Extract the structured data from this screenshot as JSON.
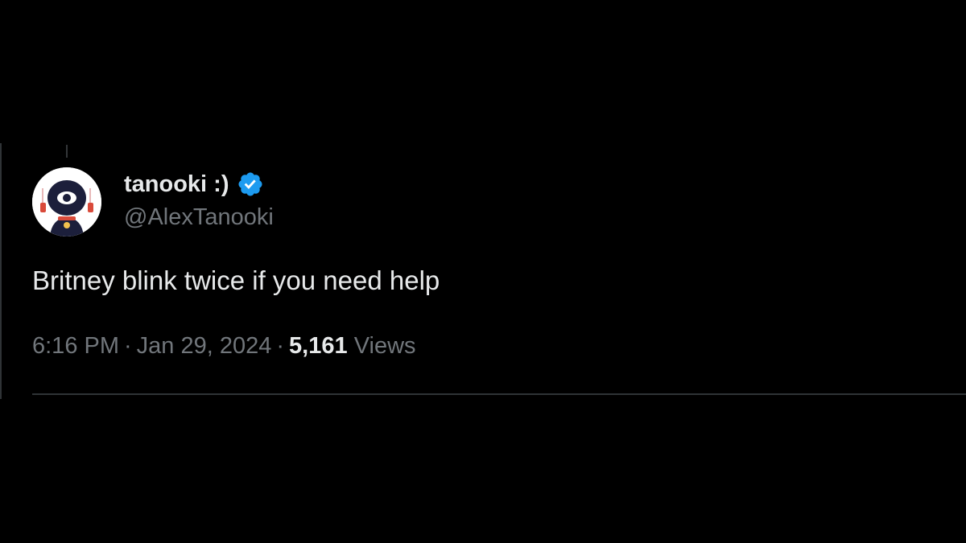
{
  "tweet": {
    "author": {
      "display_name": "tanooki :)",
      "handle": "@AlexTanooki",
      "verified": true,
      "avatar_icon": "avatar-image"
    },
    "text": "Britney blink twice if you need help",
    "meta": {
      "time": "6:16 PM",
      "separator": "·",
      "date": "Jan 29, 2024",
      "view_count": "5,161",
      "views_label": "Views"
    }
  },
  "colors": {
    "background": "#000000",
    "primary_text": "#e7e9ea",
    "secondary_text": "#71767b",
    "verified_badge": "#1d9bf0",
    "divider": "#2f3336"
  }
}
